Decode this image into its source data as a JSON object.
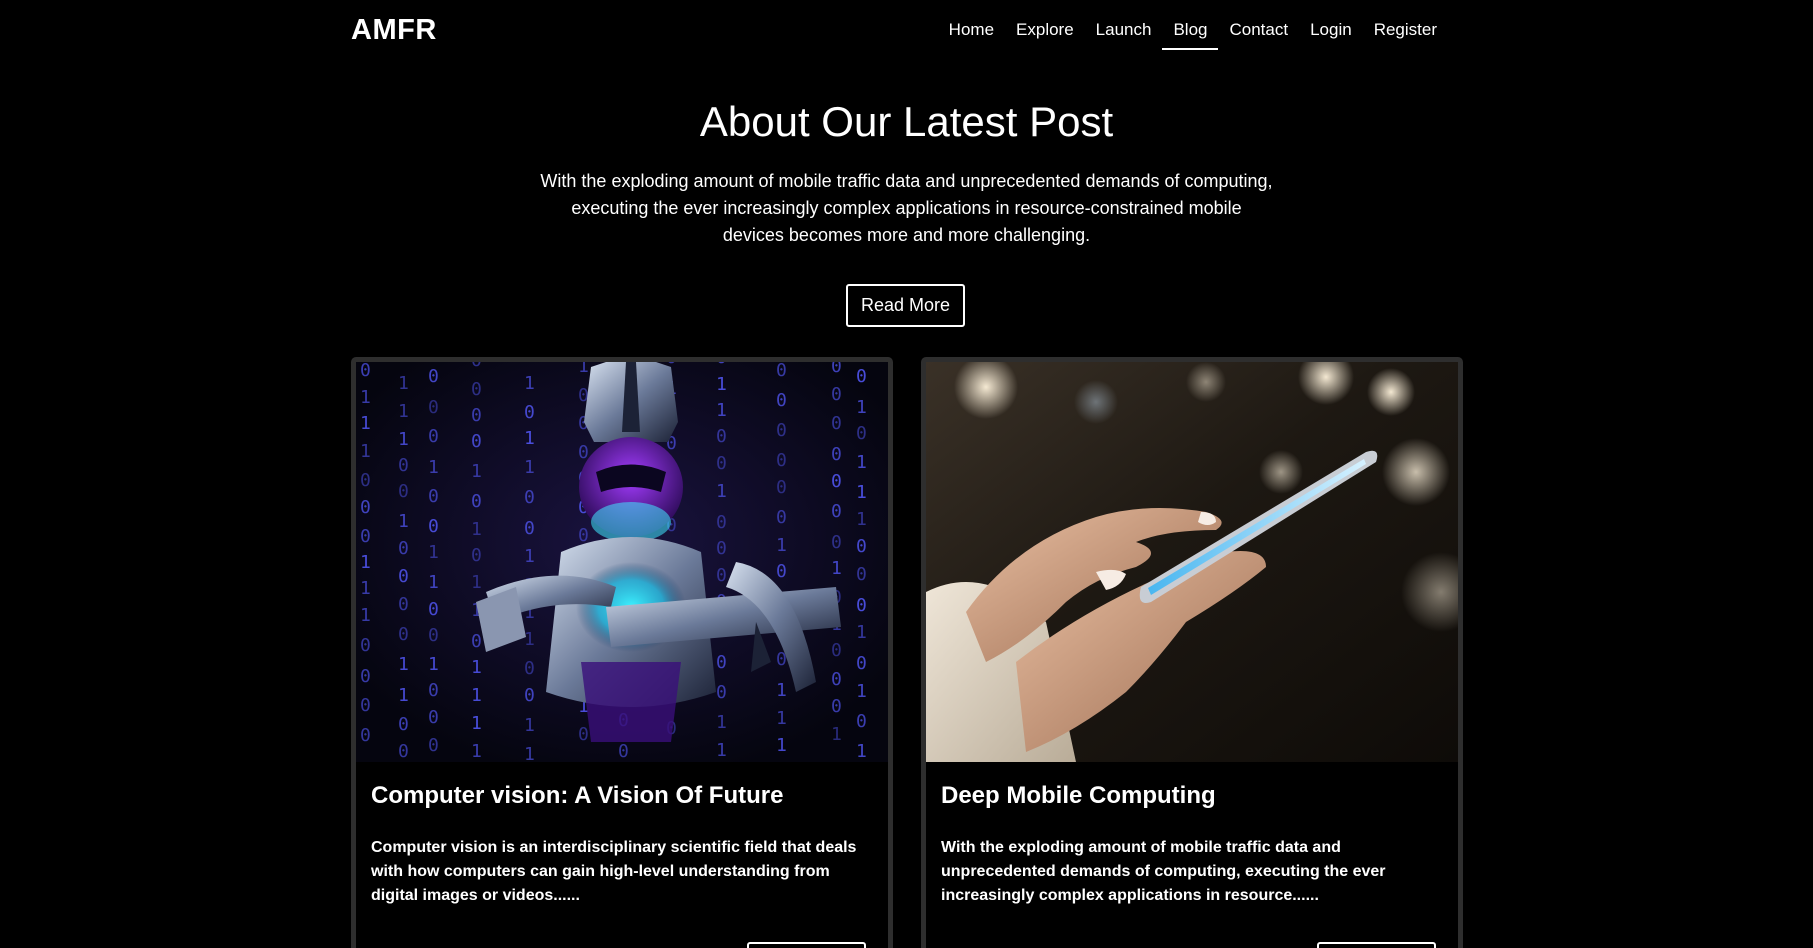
{
  "brand": "AMFR",
  "nav": {
    "items": [
      {
        "label": "Home"
      },
      {
        "label": "Explore"
      },
      {
        "label": "Launch"
      },
      {
        "label": "Blog",
        "active": true
      },
      {
        "label": "Contact"
      },
      {
        "label": "Login"
      },
      {
        "label": "Register"
      }
    ]
  },
  "hero": {
    "title": "About Our Latest Post",
    "text": "With the exploding amount of mobile traffic data and unprecedented demands of computing, executing the ever increasingly complex applications in resource-constrained mobile devices becomes more and more challenging.",
    "button": "Read More"
  },
  "cards": [
    {
      "title": "Computer vision: A Vision Of Future",
      "text": "Computer vision is an interdisciplinary scientific field that deals with how computers can gain high-level understanding from digital images or videos......",
      "image": "robot-binary-code-image"
    },
    {
      "title": "Deep Mobile Computing",
      "text": "With the exploding amount of mobile traffic data and unprecedented demands of computing, executing the ever increasingly complex applications in resource......",
      "image": "hands-smartphone-image"
    }
  ],
  "colors": {
    "background": "#000000",
    "text": "#ffffff",
    "card_border": "#2e2e2e",
    "binary_blue": "#4b4fe0",
    "robot_cyan": "#35e6f0",
    "robot_purple": "#8a2be2"
  }
}
